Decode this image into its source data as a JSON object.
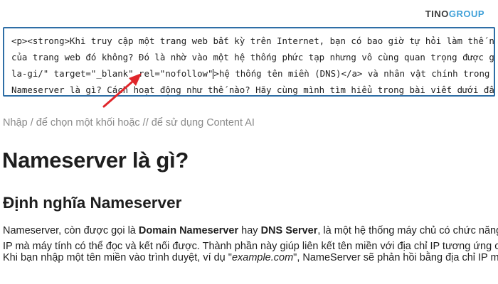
{
  "brand": {
    "logo_primary": "TINO",
    "logo_accent": "GROUP",
    "accent_color": "#3fa0d8"
  },
  "code_editor": {
    "line1": "<p><strong>Khi truy cập một trang web bất kỳ trên Internet, bạn có bao giờ tự hỏi làm thế nào",
    "line2": "của trang web đó không? Đó là nhờ vào một hệ thống phức tạp nhưng vô cùng quan trọng được gọ",
    "line3_before_caret": "la-gi/\" target=\"_blank\" rel=\"nofollow\"",
    "line3_after_caret": ">hệ thống tên miền (DNS)</a> và nhân vật chính trong b",
    "line4": "Nameserver là gì? Cách hoạt động như thế nào? Hãy cùng mình tìm hiểu trong bài viết dưới đây",
    "border_color": "#2e6ea6"
  },
  "annotation": {
    "arrow_color": "#e0262b"
  },
  "block_placeholder": "Nhập / để chọn một khối hoặc // để sử dụng Content AI",
  "heading_main": "Nameserver là gì?",
  "heading_sub": "Định nghĩa Nameserver",
  "paragraph1": {
    "line1_a": "Nameserver, còn được gọi là ",
    "line1_b": "Domain Nameserver",
    "line1_c": " hay ",
    "line1_d": "DNS Server",
    "line1_e": ", là một hệ thống máy chủ có chức năng ch",
    "line2": "IP mà máy tính có thể đọc và kết nối được. Thành phần này giúp liên kết tên miền với địa chỉ IP tương ứng củ"
  },
  "paragraph2": {
    "a": "Khi bạn nhập một tên miền vào trình duyệt, ví dụ \"",
    "b": "example.com",
    "c": "\", NameServer sẽ phản hồi bằng địa chỉ IP má"
  }
}
